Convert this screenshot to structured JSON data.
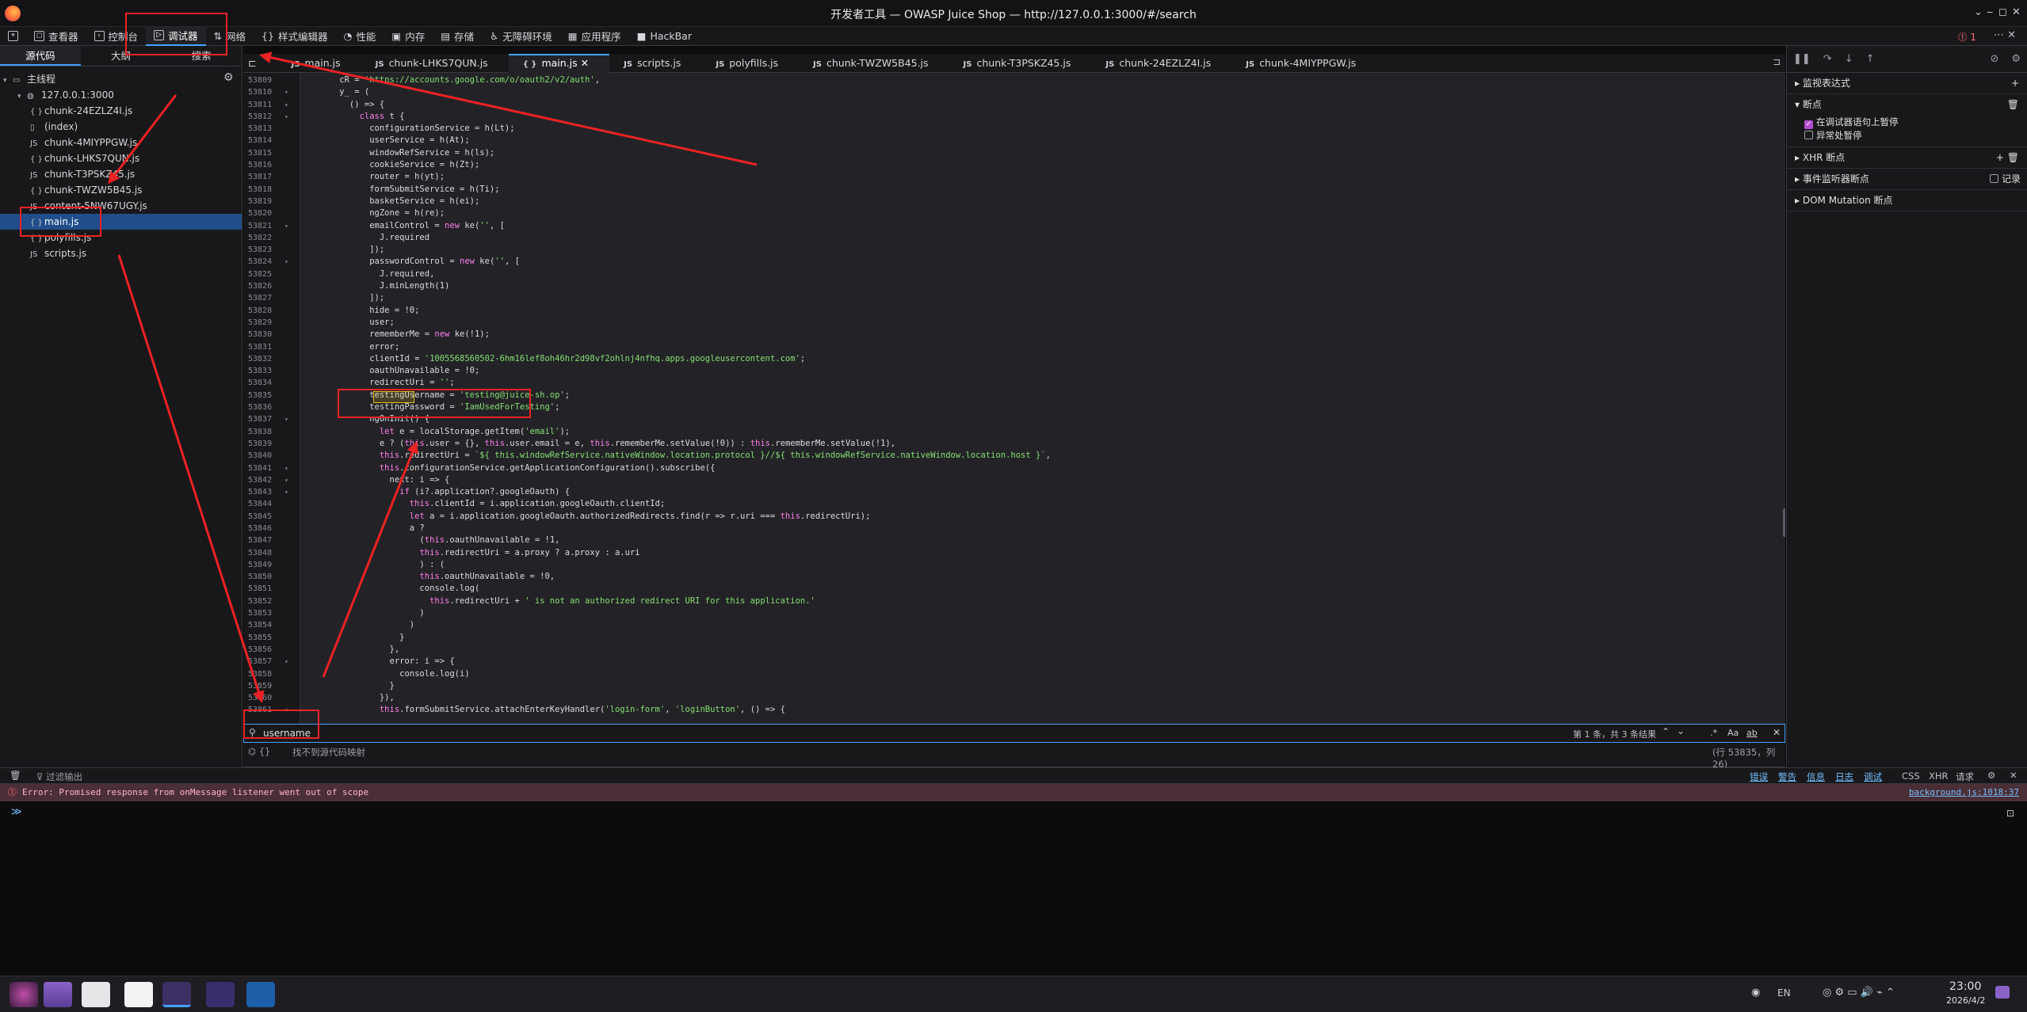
{
  "window": {
    "title": "开发者工具 — OWASP Juice Shop — http://127.0.0.1:3000/#/search",
    "controls": [
      "⌄",
      "‒",
      "◻",
      "✕"
    ]
  },
  "toolbar": {
    "tools": [
      {
        "label": "查看器",
        "icon": "inspector-icon"
      },
      {
        "label": "控制台",
        "icon": "console-icon"
      },
      {
        "label": "调试器",
        "icon": "debugger-icon"
      },
      {
        "label": "网络",
        "icon": "network-icon"
      },
      {
        "label": "样式编辑器",
        "icon": "style-editor-icon"
      },
      {
        "label": "性能",
        "icon": "performance-icon"
      },
      {
        "label": "内存",
        "icon": "memory-icon"
      },
      {
        "label": "存储",
        "icon": "storage-icon"
      },
      {
        "label": "无障碍环境",
        "icon": "accessibility-icon"
      },
      {
        "label": "应用程序",
        "icon": "application-icon"
      },
      {
        "label": "HackBar",
        "icon": "hackbar-icon"
      }
    ],
    "error_count": "1"
  },
  "sources": {
    "tabs": [
      "源代码",
      "大纲",
      "搜索"
    ],
    "root": "主线程",
    "host": "127.0.0.1:3000",
    "files": [
      {
        "name": "chunk-24EZLZ4I.js",
        "kind": "{ }"
      },
      {
        "name": "(index)",
        "kind": "page"
      },
      {
        "name": "chunk-4MIYPPGW.js",
        "kind": "JS"
      },
      {
        "name": "chunk-LHKS7QUN.js",
        "kind": "{ }"
      },
      {
        "name": "chunk-T3PSKZ45.js",
        "kind": "JS"
      },
      {
        "name": "chunk-TWZW5B45.js",
        "kind": "{ }"
      },
      {
        "name": "content-5NW67UGY.js",
        "kind": "JS"
      },
      {
        "name": "main.js",
        "kind": "{ }"
      },
      {
        "name": "polyfills.js",
        "kind": "{ }"
      },
      {
        "name": "scripts.js",
        "kind": "JS"
      }
    ]
  },
  "editor_tabs": [
    {
      "label": "main.js",
      "kind": "JS"
    },
    {
      "label": "chunk-LHKS7QUN.js",
      "kind": "JS"
    },
    {
      "label": "main.js",
      "kind": "{ }"
    },
    {
      "label": "scripts.js",
      "kind": "JS"
    },
    {
      "label": "polyfills.js",
      "kind": "JS"
    },
    {
      "label": "chunk-TWZW5B45.js",
      "kind": "JS"
    },
    {
      "label": "chunk-T3PSKZ45.js",
      "kind": "JS"
    },
    {
      "label": "chunk-24EZLZ4I.js",
      "kind": "JS"
    },
    {
      "label": "chunk-4MIYPPGW.js",
      "kind": "JS"
    }
  ],
  "code_lines": [
    {
      "n": "53809",
      "fold": "",
      "text": "    cR = 'https://accounts.google.com/o/oauth2/v2/auth',"
    },
    {
      "n": "53810",
      "fold": "▾",
      "text": "    y_ = ("
    },
    {
      "n": "53811",
      "fold": "▾",
      "text": "      () => {"
    },
    {
      "n": "53812",
      "fold": "▾",
      "text": "        class t {"
    },
    {
      "n": "53813",
      "fold": "",
      "text": "          configurationService = h(Lt);"
    },
    {
      "n": "53814",
      "fold": "",
      "text": "          userService = h(At);"
    },
    {
      "n": "53815",
      "fold": "",
      "text": "          windowRefService = h(ls);"
    },
    {
      "n": "53816",
      "fold": "",
      "text": "          cookieService = h(Zt);"
    },
    {
      "n": "53817",
      "fold": "",
      "text": "          router = h(yt);"
    },
    {
      "n": "53818",
      "fold": "",
      "text": "          formSubmitService = h(Ti);"
    },
    {
      "n": "53819",
      "fold": "",
      "text": "          basketService = h(ei);"
    },
    {
      "n": "53820",
      "fold": "",
      "text": "          ngZone = h(re);"
    },
    {
      "n": "53821",
      "fold": "▾",
      "text": "          emailControl = new ke('', ["
    },
    {
      "n": "53822",
      "fold": "",
      "text": "            J.required"
    },
    {
      "n": "53823",
      "fold": "",
      "text": "          ]);"
    },
    {
      "n": "53824",
      "fold": "▾",
      "text": "          passwordControl = new ke('', ["
    },
    {
      "n": "53825",
      "fold": "",
      "text": "            J.required,"
    },
    {
      "n": "53826",
      "fold": "",
      "text": "            J.minLength(1)"
    },
    {
      "n": "53827",
      "fold": "",
      "text": "          ]);"
    },
    {
      "n": "53828",
      "fold": "",
      "text": "          hide = !0;"
    },
    {
      "n": "53829",
      "fold": "",
      "text": "          user;"
    },
    {
      "n": "53830",
      "fold": "",
      "text": "          rememberMe = new ke(!1);"
    },
    {
      "n": "53831",
      "fold": "",
      "text": "          error;"
    },
    {
      "n": "53832",
      "fold": "",
      "text": "          clientId = '1005568560502-6hm16lef8oh46hr2d98vf2ohlnj4nfhq.apps.googleusercontent.com';"
    },
    {
      "n": "53833",
      "fold": "",
      "text": "          oauthUnavailable = !0;"
    },
    {
      "n": "53834",
      "fold": "",
      "text": "          redirectUri = '';"
    },
    {
      "n": "53835",
      "fold": "",
      "text": "          testingUsername = 'testing@juice-sh.op';"
    },
    {
      "n": "53836",
      "fold": "",
      "text": "          testingPassword = 'IamUsedForTesting';"
    },
    {
      "n": "53837",
      "fold": "▾",
      "text": "          ngOnInit() {"
    },
    {
      "n": "53838",
      "fold": "",
      "text": "            let e = localStorage.getItem('email');"
    },
    {
      "n": "53839",
      "fold": "",
      "text": "            e ? (this.user = {}, this.user.email = e, this.rememberMe.setValue(!0)) : this.rememberMe.setValue(!1),"
    },
    {
      "n": "53840",
      "fold": "",
      "text": "            this.redirectUri = `${ this.windowRefService.nativeWindow.location.protocol }//${ this.windowRefService.nativeWindow.location.host }`,"
    },
    {
      "n": "53841",
      "fold": "▾",
      "text": "            this.configurationService.getApplicationConfiguration().subscribe({"
    },
    {
      "n": "53842",
      "fold": "▾",
      "text": "              next: i => {"
    },
    {
      "n": "53843",
      "fold": "▾",
      "text": "                if (i?.application?.googleOauth) {"
    },
    {
      "n": "53844",
      "fold": "",
      "text": "                  this.clientId = i.application.googleOauth.clientId;"
    },
    {
      "n": "53845",
      "fold": "",
      "text": "                  let a = i.application.googleOauth.authorizedRedirects.find(r => r.uri === this.redirectUri);"
    },
    {
      "n": "53846",
      "fold": "",
      "text": "                  a ?"
    },
    {
      "n": "53847",
      "fold": "",
      "text": "                    (this.oauthUnavailable = !1,"
    },
    {
      "n": "53848",
      "fold": "",
      "text": "                    this.redirectUri = a.proxy ? a.proxy : a.uri"
    },
    {
      "n": "53849",
      "fold": "",
      "text": "                    ) : ("
    },
    {
      "n": "53850",
      "fold": "",
      "text": "                    this.oauthUnavailable = !0,"
    },
    {
      "n": "53851",
      "fold": "",
      "text": "                    console.log("
    },
    {
      "n": "53852",
      "fold": "",
      "text": "                      this.redirectUri + ' is not an authorized redirect URI for this application.'"
    },
    {
      "n": "53853",
      "fold": "",
      "text": "                    )"
    },
    {
      "n": "53854",
      "fold": "",
      "text": "                  )"
    },
    {
      "n": "53855",
      "fold": "",
      "text": "                }"
    },
    {
      "n": "53856",
      "fold": "",
      "text": "              },"
    },
    {
      "n": "53857",
      "fold": "▾",
      "text": "              error: i => {"
    },
    {
      "n": "53858",
      "fold": "",
      "text": "                console.log(i)"
    },
    {
      "n": "53859",
      "fold": "",
      "text": "              }"
    },
    {
      "n": "53860",
      "fold": "",
      "text": "            }),"
    },
    {
      "n": "53861",
      "fold": "▾",
      "text": "            this.formSubmitService.attachEnterKeyHandler('login-form', 'loginButton', () => {"
    }
  ],
  "search": {
    "value": "username",
    "result": "第 1 条，共 3 条结果",
    "options": [
      ".*",
      "Aa",
      "ab"
    ]
  },
  "status": {
    "source_map": "找不到源代码映射",
    "position": "(行 53835，列 26)"
  },
  "right": {
    "sections": [
      {
        "label": "监视表达式",
        "action": "+"
      },
      {
        "label": "断点",
        "action": "🗑"
      }
    ],
    "breakpoint_options": [
      {
        "label": "在调试器语句上暂停",
        "checked": true
      },
      {
        "label": "异常处暂停",
        "checked": false
      }
    ],
    "more": [
      {
        "label": "XHR 断点"
      },
      {
        "label": "事件监听器断点",
        "extra": "记录"
      },
      {
        "label": "DOM Mutation 断点"
      }
    ]
  },
  "console": {
    "filter_placeholder": "过滤输出",
    "levels": [
      "错误",
      "警告",
      "信息",
      "日志",
      "调试"
    ],
    "types": [
      "CSS",
      "XHR",
      "请求"
    ],
    "error_text": "Error: Promised response from onMessage listener went out of scope",
    "error_source": "background.js:1018:37",
    "prompt": "≫"
  },
  "tray": {
    "lang": "EN",
    "time": "23:00",
    "date": "2026/4/2"
  },
  "colors": {
    "accent": "#45a1ff",
    "annotation": "#ec2224",
    "selection": "#204e8a"
  }
}
